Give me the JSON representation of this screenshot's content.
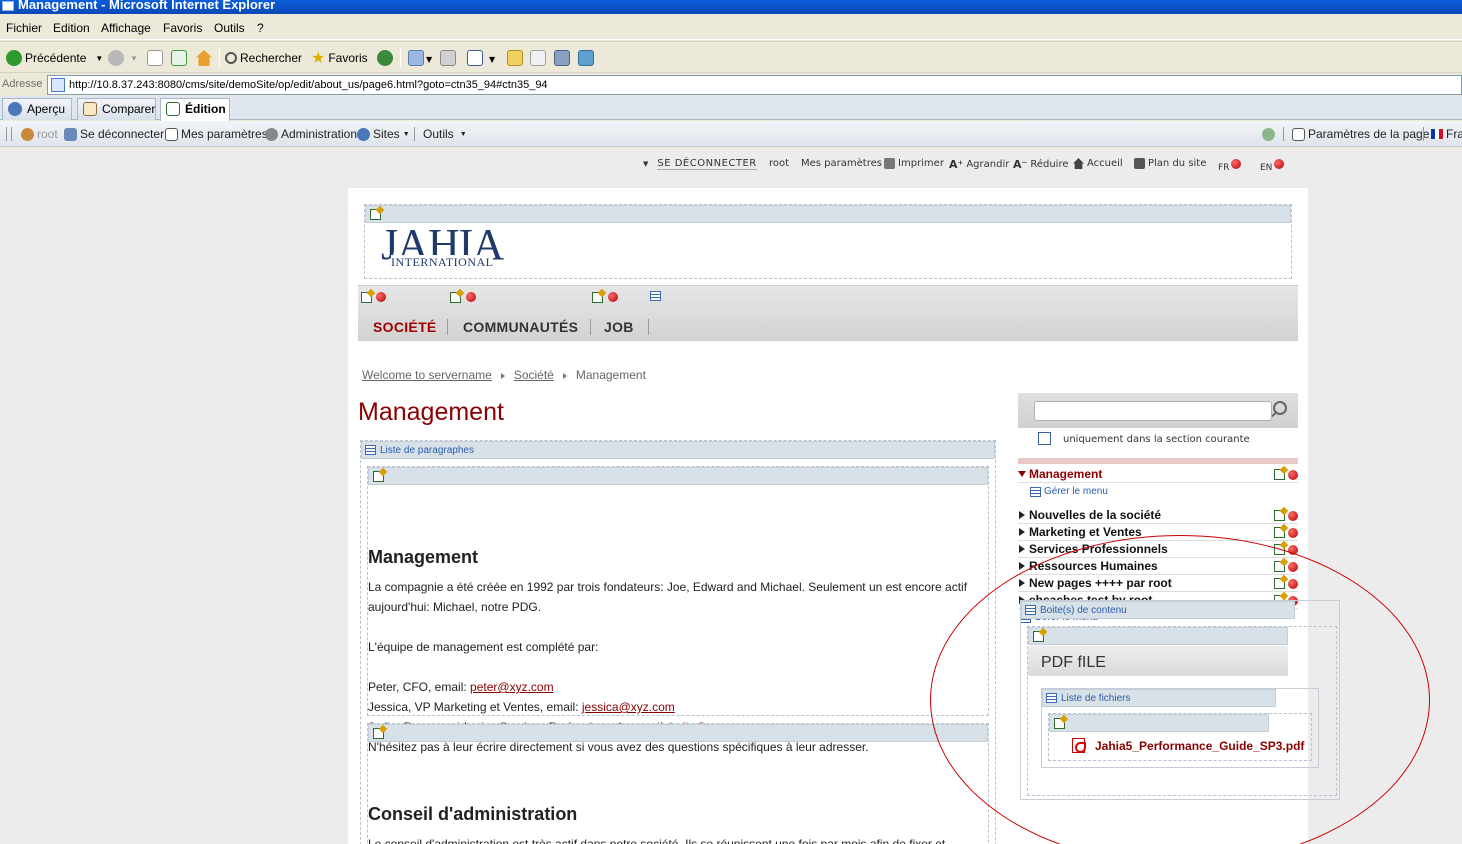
{
  "window": {
    "title": "Management - Microsoft Internet Explorer"
  },
  "menubar": [
    "Fichier",
    "Edition",
    "Affichage",
    "Favoris",
    "Outils",
    "?"
  ],
  "toolbar": {
    "back_label": "Précédente",
    "search_label": "Rechercher",
    "favorites_label": "Favoris"
  },
  "address": {
    "label": "Adresse",
    "url": "http://10.8.37.243:8080/cms/site/demoSite/op/edit/about_us/page6.html?goto=ctn35_94#ctn35_94"
  },
  "modes": [
    "Aperçu",
    "Comparer",
    "Édition"
  ],
  "jahia_toolbar": {
    "user": "root",
    "logout": "Se déconnecter",
    "settings": "Mes paramètres",
    "admin": "Administration",
    "sites": "Sites",
    "tools": "Outils",
    "page_params": "Paramètres de la page",
    "lang": "Fra"
  },
  "topnav": {
    "logout": "SE DÉCONNECTER",
    "user": "root",
    "settings": "Mes paramètres",
    "print": "Imprimer",
    "enlarge": "Agrandir",
    "reduce": "Réduire",
    "home": "Accueil",
    "sitemap": "Plan du site",
    "lang_fr": "FR",
    "lang_en": "EN"
  },
  "logo": {
    "main": "JAHIA",
    "sub": "INTERNATIONAL"
  },
  "mainnav": [
    "SOCIÉTÉ",
    "COMMUNAUTÉS",
    "JOB"
  ],
  "breadcrumb": [
    "Welcome to servername",
    "Société",
    "Management"
  ],
  "page_title": "Management",
  "paragraph_list_label": "Liste de paragraphes",
  "sections": {
    "management": {
      "title": "Management",
      "p1": "La compagnie a été créée en 1992 par trois fondateurs: Joe, Edward and Michael. Seulement un est encore actif aujourd'hui: Michael, notre PDG.",
      "p2": "L'équipe de management est complété par:",
      "peter_prefix": "Peter, CFO, email: ",
      "peter_email": "peter@xyz.com",
      "jessica_prefix": "Jessica, VP Marketing et Ventes, email: ",
      "jessica_email": "jessica@xyz.com",
      "jodie_prefix": "Jodie, Responsable des Services Professionnels, email: ",
      "jodie_email": "jodie@xyz.com",
      "closing": "N'hésitez pas à leur écrire directement si vous avez des questions spécifiques à leur adresser."
    },
    "board": {
      "title": "Conseil d'administration",
      "p1": "Le conseil d'administration est très actif dans notre société. Ils se réunissent une fois par mois afin de fixer et d'ajuster la stratégie de la compagnie pour les années à venir."
    }
  },
  "search": {
    "only_current_section": "uniquement dans la section courante"
  },
  "sidenav": {
    "active": "Management",
    "manage_menu": "Gérer le menu",
    "items": [
      "Nouvelles de la société",
      "Marketing et Ventes",
      "Services Professionnels",
      "Ressources Humaines",
      "New pages ++++ par root",
      "ehcaches test by root"
    ]
  },
  "boxes": {
    "content_boxes_label": "Boite(s) de contenu",
    "pdf_title": "PDF fILE",
    "file_list_label": "Liste de fichiers",
    "file_name": "Jahia5_Performance_Guide_SP3.pdf"
  },
  "colors": {
    "accent": "#8b0000",
    "link_blue": "#2a60a8",
    "annotation": "#cc0000"
  }
}
